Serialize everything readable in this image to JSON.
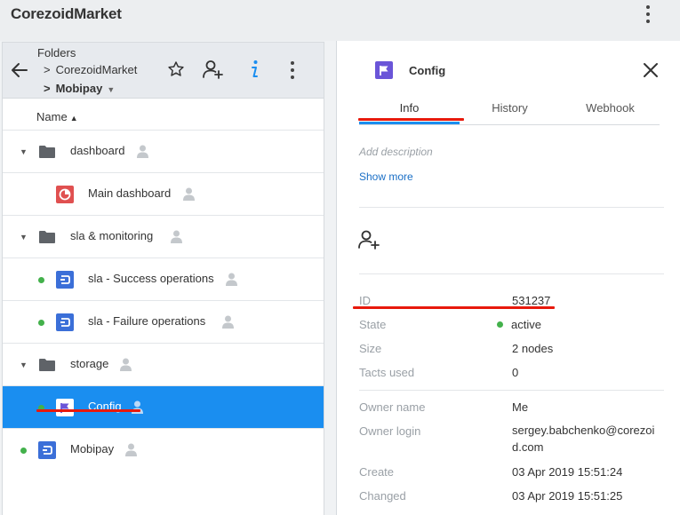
{
  "app": {
    "title": "CorezoidMarket"
  },
  "left": {
    "breadcrumb": {
      "root": "Folders",
      "level1": "CorezoidMarket",
      "level2": "Mobipay",
      "sep": ">"
    },
    "column_header": "Name",
    "rows": [
      {
        "name": "dashboard",
        "type": "folder"
      },
      {
        "name": "Main dashboard",
        "type": "dashboard"
      },
      {
        "name": "sla & monitoring",
        "type": "folder"
      },
      {
        "name": "sla - Success operations",
        "type": "process",
        "status": "active"
      },
      {
        "name": "sla - Failure operations",
        "type": "process",
        "status": "active"
      },
      {
        "name": "storage",
        "type": "folder"
      },
      {
        "name": "Config",
        "type": "config",
        "status": "active",
        "selected": true
      },
      {
        "name": "Mobipay",
        "type": "process",
        "status": "active"
      }
    ]
  },
  "right": {
    "title": "Config",
    "tabs": [
      "Info",
      "History",
      "Webhook"
    ],
    "active_tab": "Info",
    "description_placeholder": "Add description",
    "show_more": "Show more",
    "info": {
      "id_label": "ID",
      "id_value": "531237",
      "state_label": "State",
      "state_value": "active",
      "size_label": "Size",
      "size_value": "2 nodes",
      "tacts_label": "Tacts used",
      "tacts_value": "0",
      "owner_name_label": "Owner name",
      "owner_name_value": "Me",
      "owner_login_label": "Owner login",
      "owner_login_value": "sergey.babchenko@corezoid.com",
      "create_label": "Create",
      "create_value": "03 Apr 2019 15:51:24",
      "changed_label": "Changed",
      "changed_value": "03 Apr 2019 15:51:25"
    }
  },
  "colors": {
    "accent_blue": "#1a8ef0",
    "status_green": "#43b14b",
    "annotation_red": "#e8190c",
    "config_purple": "#6a55d8",
    "dashboard_red": "#e05050",
    "process_blue": "#3b6fd8"
  },
  "icons": {
    "top": "more-vertical-icon",
    "header": [
      "arrow-left-icon",
      "star-icon",
      "add-user-icon",
      "info-icon",
      "more-vertical-icon"
    ],
    "rows": [
      "folder-icon",
      "dashboard-icon",
      "process-icon",
      "config-flag-icon",
      "user-icon",
      "status-dot"
    ],
    "panel": [
      "config-flag-icon",
      "close-icon",
      "add-user-icon"
    ]
  }
}
